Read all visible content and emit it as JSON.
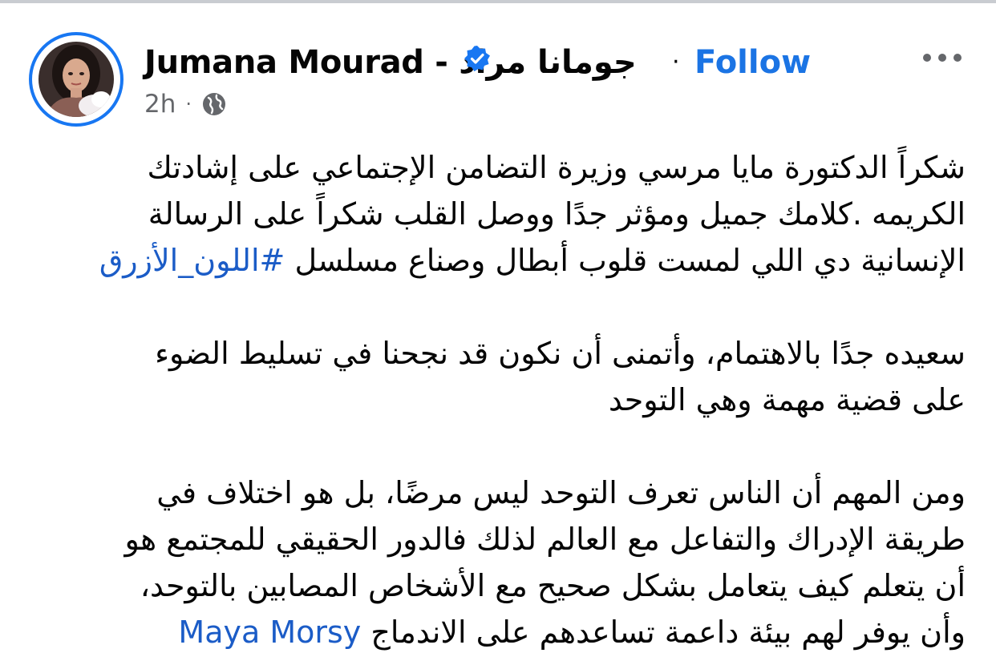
{
  "post": {
    "author": "Jumana Mourad - جومانا مراد",
    "verified": true,
    "separator": "·",
    "follow_label": "Follow",
    "timestamp": "2h",
    "meta_separator": "·",
    "audience_icon": "globe-icon",
    "more_icon": "more-horizontal-icon",
    "accent_color": "#1b74e4",
    "paragraphs": [
      {
        "lines": [
          "شكراً الدكتورة مايا مرسي وزيرة التضامن الإجتماعي على إشادتك",
          "الكريمه .كلامك جميل ومؤثر جدًا ووصل القلب شكراً على الرسالة",
          "الإنسانية دي اللي لمست قلوب أبطال وصناع مسلسل"
        ],
        "hashtag": "#اللون_الأزرق"
      },
      {
        "lines": [
          "سعيده جدًا بالاهتمام، وأتمنى أن نكون قد نجحنا في تسليط الضوء",
          "على قضية مهمة وهي التوحد"
        ]
      },
      {
        "lines": [
          "ومن المهم أن الناس تعرف التوحد ليس مرضًا، بل هو اختلاف في",
          "طريقة الإدراك والتفاعل مع العالم لذلك فالدور الحقيقي للمجتمع هو",
          "أن يتعلم كيف يتعامل بشكل صحيح مع الأشخاص المصابين بالتوحد،",
          "وأن يوفر لهم بيئة داعمة تساعدهم على الاندماج"
        ],
        "mention": "Maya Morsy"
      }
    ]
  }
}
